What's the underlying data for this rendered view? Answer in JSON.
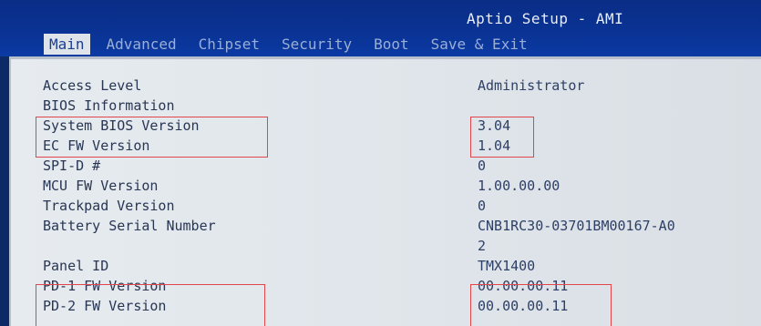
{
  "header": {
    "title": "Aptio Setup - AMI",
    "tabs": [
      "Main",
      "Advanced",
      "Chipset",
      "Security",
      "Boot",
      "Save & Exit"
    ],
    "active_tab": "Main"
  },
  "rows": [
    {
      "label": "Access Level",
      "value": "Administrator"
    },
    {
      "label": "BIOS Information",
      "value": ""
    },
    {
      "label": "System BIOS Version",
      "value": "3.04"
    },
    {
      "label": "EC FW Version",
      "value": "1.04"
    },
    {
      "label": "SPI-D #",
      "value": "0"
    },
    {
      "label": "MCU FW Version",
      "value": "1.00.00.00"
    },
    {
      "label": "Trackpad Version",
      "value": "0"
    },
    {
      "label": "Battery Serial Number",
      "value": "CNB1RC30-03701BM00167-A0"
    },
    {
      "label": "",
      "value": "2"
    },
    {
      "label": "Panel ID",
      "value": "TMX1400"
    },
    {
      "label": "PD-1 FW Version",
      "value": "00.00.00.11"
    },
    {
      "label": "PD-2 FW Version",
      "value": "00.00.00.11"
    }
  ],
  "colors": {
    "header_bg": "#0a3395",
    "panel_bg": "#e2e7ec",
    "highlight_box": "#e2454a"
  }
}
